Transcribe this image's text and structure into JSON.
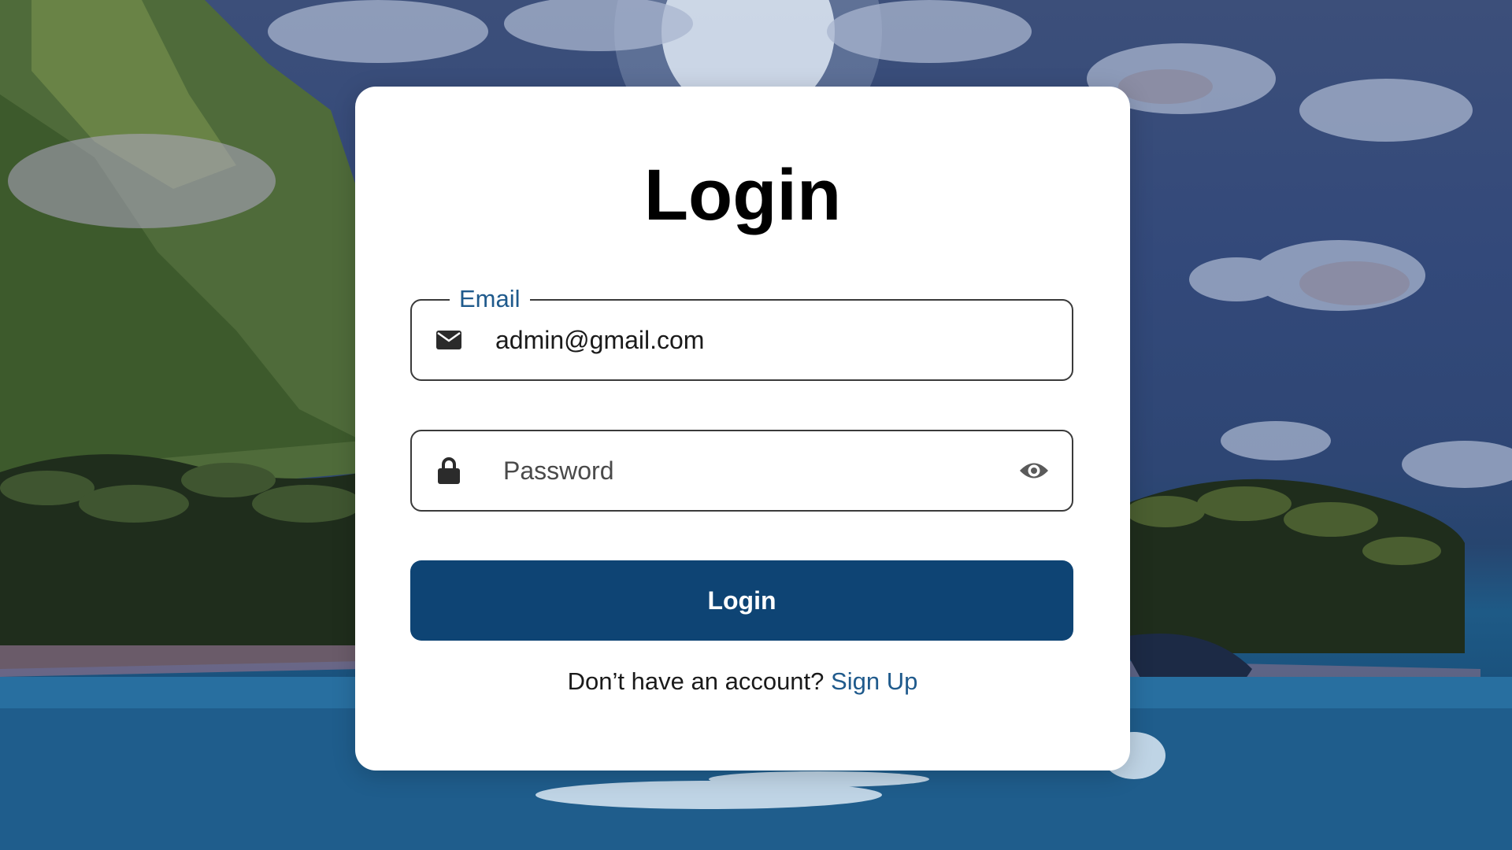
{
  "page": {
    "title": "Login"
  },
  "email_field": {
    "label": "Email",
    "value": "admin@gmail.com",
    "icon": "envelope-icon"
  },
  "password_field": {
    "placeholder": "Password",
    "value": "",
    "icon": "lock-icon",
    "toggle_icon": "eye-icon"
  },
  "login_button": {
    "label": "Login"
  },
  "signup": {
    "prompt": "Don’t have an account?",
    "link_label": "Sign Up"
  },
  "colors": {
    "primary": "#0e4474",
    "link": "#1f5a8c",
    "card_background": "#ffffff"
  }
}
